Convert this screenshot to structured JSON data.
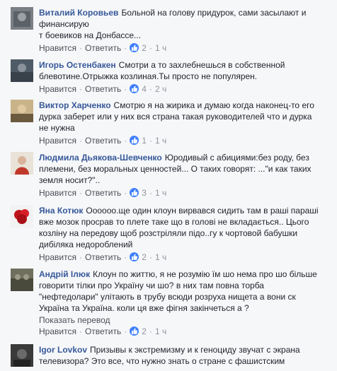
{
  "comments": [
    {
      "author": "Виталий Коровьев",
      "lines": [
        "Больной на голову придурок, сами засылают и",
        "финансирую",
        "т боевиков на Донбассе..."
      ],
      "like_label": "Нравится",
      "reply_label": "Ответить",
      "likes": "2",
      "time": "1 ч"
    },
    {
      "author": "Игорь Остенбакен",
      "lines": [
        "Смотри а то захлебнешься в собственной",
        "блевотине.Отрыжка козлиная.Ты просто не популярен."
      ],
      "like_label": "Нравится",
      "reply_label": "Ответить",
      "likes": "4",
      "time": "2 ч"
    },
    {
      "author": "Виктор Харченко",
      "lines": [
        "Смотрю я на жирика и думаю когда наконец-то его",
        "дурка заберет или у них вся страна такая руководителей что и дурка",
        "не нужна"
      ],
      "like_label": "Нравится",
      "reply_label": "Ответить",
      "likes": "1",
      "time": "1 ч"
    },
    {
      "author": "Людмила Дьякова-Шевченко",
      "lines": [
        "Юродивый с абициями:без роду, без",
        "племени, без моральных ценностей... О таких говорят: ...\"и как таких",
        "земля носит?\".."
      ],
      "like_label": "Нравится",
      "reply_label": "Ответить",
      "likes": "3",
      "time": "1 ч"
    },
    {
      "author": "Яна Котюк",
      "lines": [
        "Оооооо.ще один клоун вирвався сидить там в раші параші",
        "вже мозок просрав то плете таке що в голові не вкладається.. Цього",
        "козліну на передову щоб розстріляли підо..гу к чортовой бабушки",
        "дибіляка недороблений"
      ],
      "like_label": "Нравится",
      "reply_label": "Ответить",
      "likes": "2",
      "time": "1 ч"
    },
    {
      "author": "Андрій Ілюк",
      "lines": [
        "Клоун по життю, я не розумію їм шо нема про шо більше",
        "говорити тілки про Україну чи шо? в них там повна торба",
        "\"нефтедолари\" улітають в трубу всюди розруха нищета а вони ск",
        "Україна та Україна. коли ця вже фігня закінчеться а ?"
      ],
      "translate_label": "Показать перевод",
      "like_label": "Нравится",
      "reply_label": "Ответить",
      "likes": "2",
      "time": "1 ч"
    },
    {
      "author": "Igor Lovkov",
      "lines": [
        "Призывы к экстремизму и к геноциду звучат с экрана",
        "телевизора? Это все, что нужно знать о стране с фашистским"
      ]
    }
  ]
}
